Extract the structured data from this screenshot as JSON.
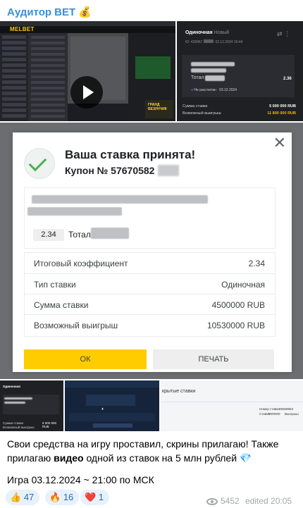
{
  "channel": {
    "author": "Аудитор BET 💰"
  },
  "video_thumb": {
    "logo": "MELBET",
    "promo": "ГРАНД ВЕЗУНЧИК"
  },
  "bet_preview": {
    "type": "Одиночная",
    "status_new": "Новый",
    "id_prefix": "ID: 428467",
    "id_date": "02.12.2024 16:44",
    "total_label": "Тотал",
    "odd": "2.36",
    "status_label": "Не рассчитан",
    "status_date": "03.12.2024",
    "stake_label": "Сумма ставки",
    "stake_value": "5 000 000 RUB",
    "win_label": "Возможный выигрыш",
    "win_value": "11 800 000 RUB",
    "win_color": "#f2b705"
  },
  "dialog": {
    "title": "Ваша ставка принята!",
    "coupon": "Купон № 57670582",
    "odd": "2.34",
    "total_label": "Тотал",
    "rows": [
      {
        "label": "Итоговый коэффициент",
        "value": "2.34"
      },
      {
        "label": "Тип ставки",
        "value": "Одиночная"
      },
      {
        "label": "Сумма ставки",
        "value": "4500000 RUB"
      },
      {
        "label": "Возможный выигрыш",
        "value": "10530000 RUB"
      }
    ],
    "ok_label": "ОК",
    "print_label": "ПЕЧАТЬ",
    "accent": "#ffcc00"
  },
  "thumbs": {
    "third_title": "крытые ставки",
    "third_stake_label": "Номер ставки",
    "third_stake_value": "05559963",
    "third_amount_label": "Ставка",
    "third_amount_value": "7000000",
    "third_win_label": "Выигрыш"
  },
  "message": {
    "line1_a": "Свои средства на игру проставил, скрины прилагаю! Также прилагаю ",
    "line1_bold": "видео",
    "line1_b": " одной из ставок на 5 млн рублей 💎",
    "line2": "Игра 03.12.2024 ~ 21:00 по МСК"
  },
  "reactions": [
    {
      "emoji": "👍",
      "count": "47"
    },
    {
      "emoji": "🔥",
      "count": "16"
    },
    {
      "emoji": "❤️",
      "count": "1"
    }
  ],
  "footer": {
    "views": "5452",
    "edited": "edited 20:05"
  }
}
